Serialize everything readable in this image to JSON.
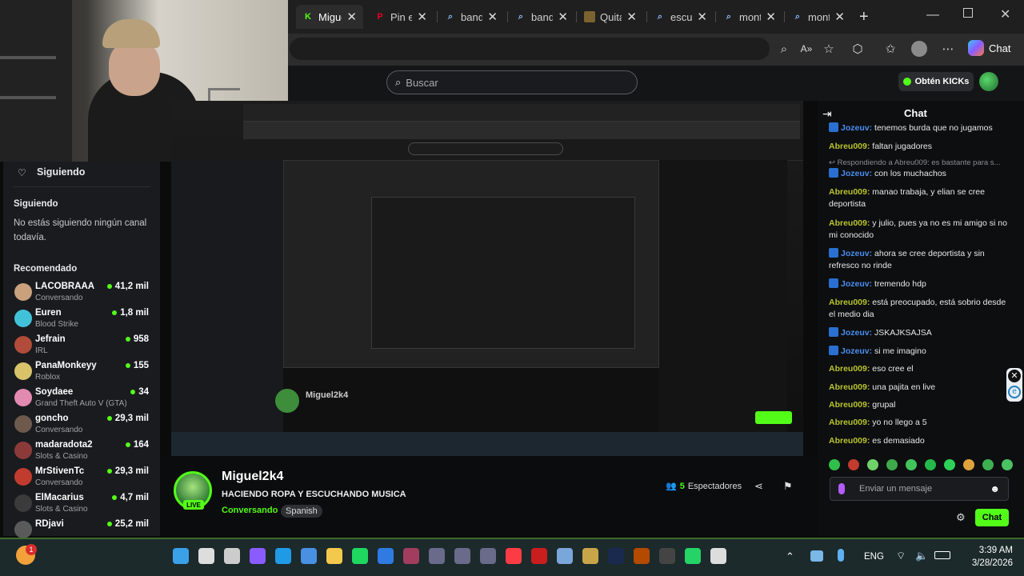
{
  "browser": {
    "tabs": [
      {
        "label": "Migue",
        "active": true
      },
      {
        "label": "Pin en"
      },
      {
        "label": "band"
      },
      {
        "label": "band"
      },
      {
        "label": "Quita"
      },
      {
        "label": "escu"
      },
      {
        "label": "mont"
      },
      {
        "label": "mont"
      }
    ],
    "copilot_label": "Chat"
  },
  "header": {
    "search_placeholder": "Buscar",
    "get_kicks": "Obtén KICKs"
  },
  "sidebar": {
    "following_header": "Siguiendo",
    "following_title": "Siguiendo",
    "following_empty": "No estás siguiendo ningún canal todavía.",
    "recommended_title": "Recomendado",
    "channels": [
      {
        "name": "LACOBRAAA",
        "category": "Conversando",
        "viewers": "41,2 mil",
        "color": "#c9a17c"
      },
      {
        "name": "Euren",
        "category": "Blood Strike",
        "viewers": "1,8 mil",
        "color": "#42c2d9"
      },
      {
        "name": "Jefrain",
        "category": "IRL",
        "viewers": "958",
        "color": "#b14c3a"
      },
      {
        "name": "PanaMonkeyy",
        "category": "Roblox",
        "viewers": "155",
        "color": "#d8c36a"
      },
      {
        "name": "Soydaee",
        "category": "Grand Theft Auto V (GTA)",
        "viewers": "34",
        "color": "#e38ab0"
      },
      {
        "name": "goncho",
        "category": "Conversando",
        "viewers": "29,3 mil",
        "color": "#6d5a4c"
      },
      {
        "name": "madaradota2",
        "category": "Slots & Casino",
        "viewers": "164",
        "color": "#8b3a3a"
      },
      {
        "name": "MrStivenTc",
        "category": "Conversando",
        "viewers": "29,3 mil",
        "color": "#c23b2f"
      },
      {
        "name": "ElMacarius",
        "category": "Slots & Casino",
        "viewers": "4,7 mil",
        "color": "#3b3b3b"
      },
      {
        "name": "RDjavi",
        "category": "",
        "viewers": "25,2 mil",
        "color": "#5a5a5a"
      }
    ]
  },
  "stream": {
    "streamer": "Miguel2k4",
    "live": "LIVE",
    "title": "HACIENDO ROPA Y ESCUCHANDO MUSICA",
    "category": "Conversando",
    "language": "Spanish",
    "viewer_count": "5",
    "viewer_label": "Espectadores"
  },
  "chat": {
    "title": "Chat",
    "reply_hint": "Respondiendo a Abreu009: es bastante para s...",
    "messages": [
      {
        "user": "Jozeuv",
        "text": "tenemos burda que no jugamos",
        "type": "b"
      },
      {
        "user": "Abreu009",
        "text": "faltan jugadores",
        "type": "g"
      },
      {
        "user": "Jozeuv",
        "text": "con los muchachos",
        "type": "b"
      },
      {
        "user": "Abreu009",
        "text": "manao trabaja, y elian se cree deportista",
        "type": "g"
      },
      {
        "user": "Abreu009",
        "text": "y julio, pues ya no es mi amigo si no mi conocido",
        "type": "g"
      },
      {
        "user": "Jozeuv",
        "text": "ahora se cree deportista y sin refresco no rinde",
        "type": "b"
      },
      {
        "user": "Jozeuv",
        "text": "tremendo hdp",
        "type": "b"
      },
      {
        "user": "Abreu009",
        "text": "está preocupado, está sobrio desde el medio dia",
        "type": "g"
      },
      {
        "user": "Jozeuv",
        "text": "JSKAJKSAJSA",
        "type": "b"
      },
      {
        "user": "Jozeuv",
        "text": "si me imagino",
        "type": "b"
      },
      {
        "user": "Abreu009",
        "text": "eso cree el",
        "type": "g"
      },
      {
        "user": "Abreu009",
        "text": "una pajita en live",
        "type": "g"
      },
      {
        "user": "Abreu009",
        "text": "grupal",
        "type": "g"
      },
      {
        "user": "Abreu009",
        "text": "yo no llego a 5",
        "type": "g"
      },
      {
        "user": "Abreu009",
        "text": "es demasiado",
        "type": "g"
      }
    ],
    "input_placeholder": "Enviar un mensaje",
    "send_label": "Chat"
  },
  "taskbar": {
    "lang": "ENG",
    "time": "3:39 AM",
    "date": "3/28/2026",
    "notification_count": "1"
  },
  "colors": {
    "kick_green": "#53fc18",
    "chat_user_green": "#b9c42e",
    "chat_user_blue": "#4a8ff0"
  }
}
